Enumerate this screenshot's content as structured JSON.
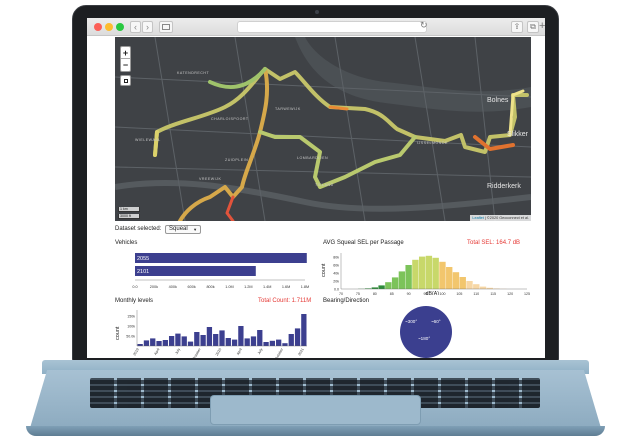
{
  "colors": {
    "accent_bar": "#3c3f8f",
    "total_red": "#e53935",
    "map_bg": "#3f4246"
  },
  "browser": {
    "back_icon": "chevron-left-icon",
    "forward_icon": "chevron-right-icon",
    "reload_icon": "reload-icon",
    "share_icon": "share-icon",
    "tabs_icon": "tabs-icon",
    "newtab": "+"
  },
  "map": {
    "zoom_in": "+",
    "zoom_out": "−",
    "district_labels": [
      "KATENDRECHT",
      "CHARLOISPOORT",
      "TARWEWIJK",
      "WIELEWAAL",
      "ZUIDPLEIN",
      "LOMBARDIJEN",
      "VREEWIJK",
      "TIELAND",
      "IJSSELMONDE"
    ],
    "towns": [
      "Bolnes",
      "Slikker",
      "Ridderkerk"
    ],
    "scale_km": "1 km",
    "scale_ft": "3000 ft",
    "attribution_link": "Leaflet",
    "attribution_text": "| ©2020 Geoconnect et al."
  },
  "dataset": {
    "label": "Dataset selected:",
    "value": "Squeal"
  },
  "vehicles": {
    "title": "Vehicles",
    "rows": [
      {
        "label": "2055",
        "value": 1.92
      },
      {
        "label": "2101",
        "value": 1.35
      }
    ],
    "ticks": [
      "0.0",
      "200k",
      "400k",
      "600k",
      "800k",
      "1.0M",
      "1.2M",
      "1.4M",
      "1.6M",
      "1.8M"
    ]
  },
  "avg_sel": {
    "title": "AVG Squeal SEL per Passage",
    "total": "Total SEL: 164.7 dB",
    "ylabel": "count",
    "xlabel": "dB(A)",
    "yticks": [
      "0.0",
      "20k",
      "40k",
      "60k",
      "80k"
    ],
    "xticks": [
      "70",
      "75",
      "80",
      "85",
      "90",
      "95",
      "100",
      "105",
      "110",
      "115",
      "120",
      "125"
    ]
  },
  "monthly": {
    "title": "Monthly levels",
    "total": "Total Count: 1.711M",
    "ylabel": "count",
    "yticks": [
      "50.0k",
      "100k",
      "150k"
    ],
    "xticks": [
      "2019",
      "April",
      "July",
      "October",
      "2020",
      "April",
      "July",
      "October",
      "2021"
    ]
  },
  "bearing": {
    "title": "Bearing/Direction",
    "labels": [
      "~300°",
      "~60°",
      "~180°"
    ]
  },
  "chart_data": [
    {
      "type": "bar",
      "title": "Vehicles",
      "orientation": "horizontal",
      "categories": [
        "2055",
        "2101"
      ],
      "values": [
        1920000,
        1350000
      ],
      "xlim": [
        0,
        1900000
      ]
    },
    {
      "type": "bar",
      "title": "AVG Squeal SEL per Passage",
      "xlabel": "dB(A)",
      "ylabel": "count",
      "xlim": [
        70,
        125
      ],
      "ylim": [
        0,
        90000
      ],
      "x": [
        76,
        78,
        80,
        82,
        84,
        86,
        88,
        90,
        92,
        94,
        96,
        98,
        100,
        102,
        104,
        106,
        108,
        110,
        112,
        114,
        116,
        118
      ],
      "values": [
        500,
        1500,
        4000,
        9000,
        17000,
        29000,
        44000,
        60000,
        73000,
        81000,
        83000,
        78000,
        68000,
        55000,
        42000,
        30000,
        20000,
        12000,
        6000,
        3000,
        1200,
        400
      ]
    },
    {
      "type": "bar",
      "title": "Monthly levels",
      "ylabel": "count",
      "ylim": [
        0,
        180000
      ],
      "values": [
        10000,
        28000,
        38000,
        25000,
        30000,
        50000,
        62000,
        48000,
        22000,
        70000,
        55000,
        95000,
        60000,
        78000,
        40000,
        32000,
        100000,
        38000,
        48000,
        80000,
        20000,
        26000,
        32000,
        14000,
        60000,
        88000,
        160000
      ]
    }
  ]
}
